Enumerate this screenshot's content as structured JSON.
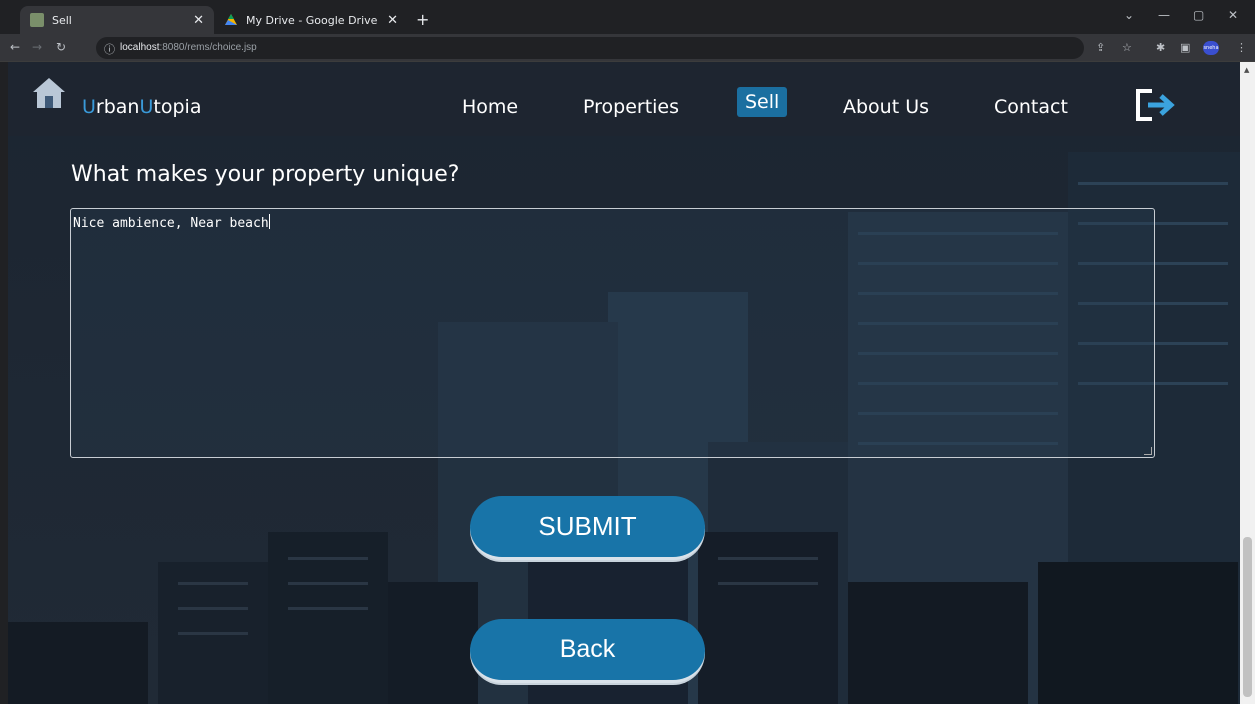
{
  "browser": {
    "tabs": [
      {
        "title": "Sell",
        "active": true
      },
      {
        "title": "My Drive - Google Drive",
        "active": false
      }
    ],
    "url_host": "localhost",
    "url_rest": ":8080/rems/choice.jsp",
    "profile_label": "sneha"
  },
  "site": {
    "brand_first": "U",
    "brand_mid": "rban",
    "brand_second": "U",
    "brand_last": "topia",
    "nav": [
      {
        "label": "Home"
      },
      {
        "label": "Properties"
      },
      {
        "label": "Sell",
        "active": true
      },
      {
        "label": "About Us"
      },
      {
        "label": "Contact"
      }
    ]
  },
  "form": {
    "question": "What makes your property unique?",
    "answer_value": "Nice ambience, Near beach",
    "submit_label": "SUBMIT",
    "back_label": "Back"
  },
  "colors": {
    "accent": "#1874a8",
    "brand_highlight": "#3a9ad9",
    "header_bg": "#1e2630"
  }
}
